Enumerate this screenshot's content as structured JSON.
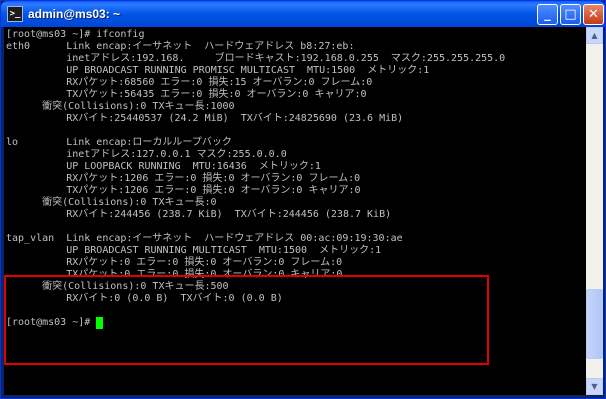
{
  "window": {
    "title": "admin@ms03: ~",
    "buttons": {
      "minimize": "_",
      "maximize": "□",
      "close": "✕"
    }
  },
  "terminal": {
    "lines": [
      "[root@ms03 ~]# ifconfig",
      "eth0      Link encap:イーサネット  ハードウェアドレス b8:27:eb:",
      "          inetアドレス:192.168.     ブロードキャスト:192.168.0.255  マスク:255.255.255.0",
      "          UP BROADCAST RUNNING PROMISC MULTICAST  MTU:1500  メトリック:1",
      "          RXパケット:68560 エラー:0 損失:15 オーバラン:0 フレーム:0",
      "          TXパケット:56435 エラー:0 損失:0 オーバラン:0 キャリア:0",
      "      衝突(Collisions):0 TXキュー長:1000",
      "          RXバイト:25440537 (24.2 MiB)  TXバイト:24825690 (23.6 MiB)",
      "",
      "lo        Link encap:ローカルループバック",
      "          inetアドレス:127.0.0.1 マスク:255.0.0.0",
      "          UP LOOPBACK RUNNING  MTU:16436  メトリック:1",
      "          RXパケット:1206 エラー:0 損失:0 オーバラン:0 フレーム:0",
      "          TXパケット:1206 エラー:0 損失:0 オーバラン:0 キャリア:0",
      "      衝突(Collisions):0 TXキュー長:0",
      "          RXバイト:244456 (238.7 KiB)  TXバイト:244456 (238.7 KiB)",
      "",
      "tap_vlan  Link encap:イーサネット  ハードウェアドレス 00:ac:09:19:30:ae",
      "          UP BROADCAST RUNNING MULTICAST  MTU:1500  メトリック:1",
      "          RXパケット:0 エラー:0 損失:0 オーバラン:0 フレーム:0",
      "          TXパケット:0 エラー:0 損失:0 オーバラン:0 キャリア:0",
      "      衝突(Collisions):0 TXキュー長:500",
      "          RXバイト:0 (0.0 B)  TXバイト:0 (0.0 B)",
      "",
      "[root@ms03 ~]# "
    ]
  },
  "colors": {
    "terminal_bg": "#000000",
    "terminal_fg": "#c0c0c0",
    "cursor": "#00ff00",
    "highlight_border": "#e00000"
  }
}
